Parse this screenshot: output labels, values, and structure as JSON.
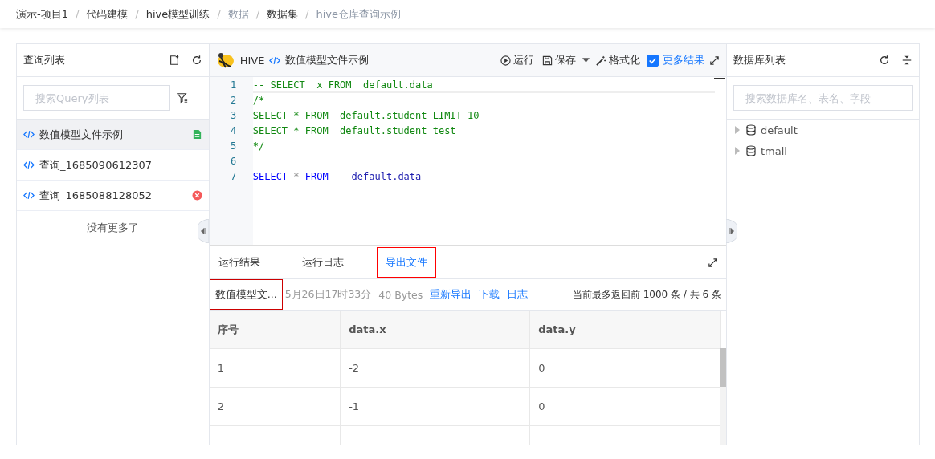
{
  "breadcrumb": [
    {
      "label": "演示-项目1",
      "muted": false
    },
    {
      "label": "代码建模",
      "muted": false
    },
    {
      "label": "hive模型训练",
      "muted": false
    },
    {
      "label": "数据",
      "muted": true
    },
    {
      "label": "数据集",
      "muted": false
    },
    {
      "label": "hive仓库查询示例",
      "muted": true
    }
  ],
  "breadcrumb_separator": "/",
  "query_panel": {
    "title": "查询列表",
    "search": {
      "placeholder": "搜索Query列表"
    },
    "items": [
      {
        "label": "数值模型文件示例",
        "selected": true,
        "kind": "file"
      },
      {
        "label": "查询_1685090612307",
        "selected": false,
        "kind": "plain"
      },
      {
        "label": "查询_1685088128052",
        "selected": false,
        "kind": "error"
      }
    ],
    "footer": "没有更多了"
  },
  "editor": {
    "engine": "HIVE",
    "file": "数值模型文件示例",
    "toolbar": {
      "run": "运行",
      "save": "保存",
      "format": "格式化",
      "more_results": {
        "label": "更多结果",
        "checked": true
      }
    },
    "lines": [
      {
        "number": "1",
        "tokens": [
          {
            "kind": "comment",
            "text": "-- SELECT  x FROM  default.data"
          }
        ]
      },
      {
        "number": "2",
        "tokens": [
          {
            "kind": "comment",
            "text": "/*"
          }
        ]
      },
      {
        "number": "3",
        "tokens": [
          {
            "kind": "comment",
            "text": "SELECT * FROM  default.student LIMIT 10"
          }
        ]
      },
      {
        "number": "4",
        "tokens": [
          {
            "kind": "comment",
            "text": "SELECT * FROM  default.student_test"
          }
        ]
      },
      {
        "number": "5",
        "tokens": [
          {
            "kind": "comment",
            "text": "*/"
          }
        ]
      },
      {
        "number": "6"
      },
      {
        "number": "7",
        "tokens": [
          {
            "kind": "keyword",
            "text": "SELECT"
          },
          {
            "kind": "plain",
            "text": " * "
          },
          {
            "kind": "keyword",
            "text": "FROM"
          },
          {
            "kind": "ident",
            "text": "    default.data"
          }
        ]
      }
    ]
  },
  "result_tabs": [
    {
      "label": "运行结果",
      "selected": false,
      "highlighted": false
    },
    {
      "label": "运行日志",
      "selected": false,
      "highlighted": false
    },
    {
      "label": "导出文件",
      "selected": true,
      "highlighted": true
    }
  ],
  "export_bar": {
    "file": {
      "label": "数值模型文...",
      "highlighted": true
    },
    "time": "5月26日17时33分",
    "size": "40 Bytes",
    "actions": [
      "重新导出",
      "下载",
      "日志"
    ],
    "summary": "当前最多返回前 1000 条 / 共 6 条"
  },
  "table": {
    "columns": [
      "序号",
      "data.x",
      "data.y"
    ],
    "rows": [
      [
        "1",
        "-2",
        "0"
      ],
      [
        "2",
        "-1",
        "0"
      ]
    ]
  },
  "database_panel": {
    "title": "数据库列表",
    "search": {
      "placeholder": "搜索数据库名、表名、字段"
    },
    "tree": [
      {
        "label": "default",
        "expanded": false
      },
      {
        "label": "tmall",
        "expanded": false
      }
    ]
  }
}
